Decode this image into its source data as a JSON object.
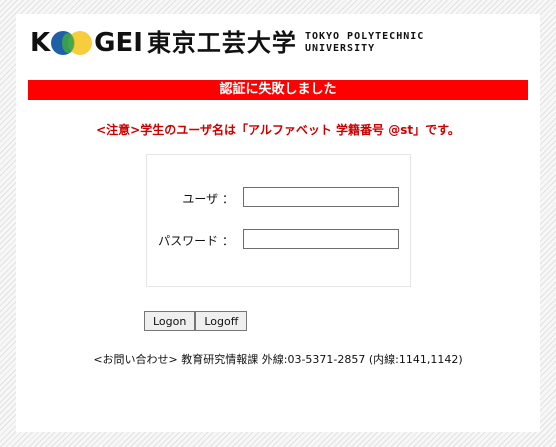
{
  "logo": {
    "text_k": "K",
    "text_gei": "GEI",
    "jp_name": "東京工芸大学",
    "en_line1": "TOKYO POLYTECHNIC",
    "en_line2": "UNIVERSITY"
  },
  "error": {
    "message": "認証に失敗しました",
    "color": "#ff0000"
  },
  "notice": {
    "text": "<注意>学生のユーザ名は「アルファベット 学籍番号 @st」です。",
    "color": "#cc0000"
  },
  "form": {
    "username_label": "ユーザ ：",
    "username_value": "",
    "password_label": "パスワード ：",
    "password_value": ""
  },
  "buttons": {
    "logon": "Logon",
    "logoff": "Logoff"
  },
  "footer": {
    "contact": "<お問い合わせ>  教育研究情報課  外線:03-5371-2857 (内線:1141,1142)"
  }
}
